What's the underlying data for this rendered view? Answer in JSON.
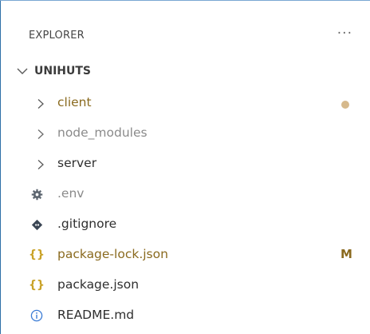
{
  "explorer": {
    "title": "EXPLORER",
    "more_icon": "more-actions-icon",
    "more_glyph": "···"
  },
  "section": {
    "title": "UNIHUTS",
    "expanded": true
  },
  "items": [
    {
      "label": "client",
      "type": "folder",
      "status": "modified-dot"
    },
    {
      "label": "node_modules",
      "type": "folder",
      "status": "ignored"
    },
    {
      "label": "server",
      "type": "folder",
      "status": ""
    },
    {
      "label": ".env",
      "type": "file",
      "icon": "gear-icon",
      "status": "ignored"
    },
    {
      "label": ".gitignore",
      "type": "file",
      "icon": "git-icon",
      "status": ""
    },
    {
      "label": "package-lock.json",
      "type": "file",
      "icon": "json-icon",
      "glyph": "{}",
      "status": "modified",
      "badge": "M"
    },
    {
      "label": "package.json",
      "type": "file",
      "icon": "json-icon",
      "glyph": "{}",
      "status": ""
    },
    {
      "label": "README.md",
      "type": "file",
      "icon": "info-icon",
      "status": ""
    }
  ],
  "colors": {
    "accent_border": "#2e6fa7",
    "modified_text": "#8a6a1f",
    "ignored_text": "#8a8a8a",
    "json_icon": "#c9a227",
    "info_icon": "#3a7bd5",
    "dot": "#d6b98c"
  }
}
